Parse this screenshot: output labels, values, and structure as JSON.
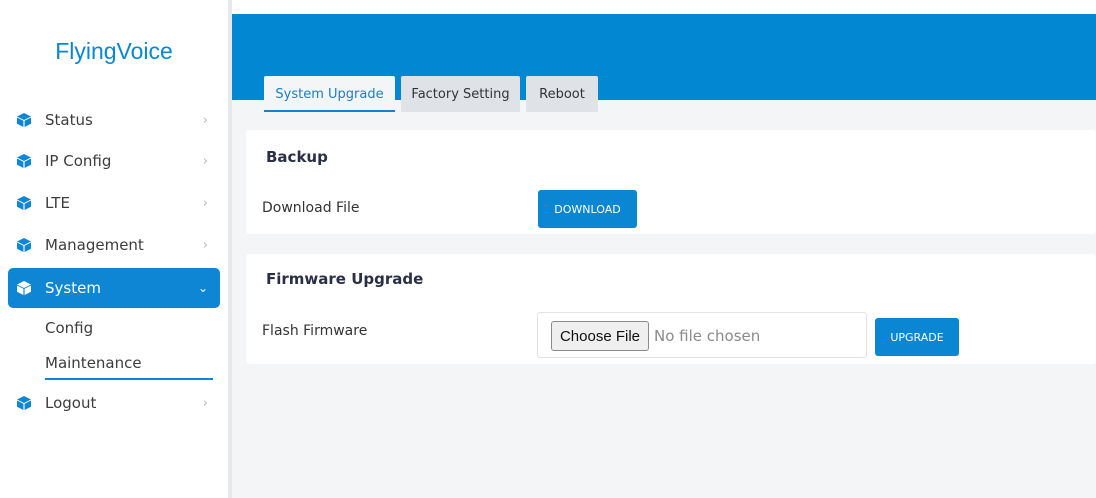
{
  "app": {
    "logo_text": "FlyingVoice"
  },
  "sidebar": {
    "items": [
      {
        "label": "Status",
        "icon": "cube-icon",
        "chevron": "›"
      },
      {
        "label": "IP Config",
        "icon": "cube-icon",
        "chevron": "›"
      },
      {
        "label": "LTE",
        "icon": "cube-icon",
        "chevron": "›"
      },
      {
        "label": "Management",
        "icon": "cube-icon",
        "chevron": "›"
      },
      {
        "label": "System",
        "icon": "cube-icon",
        "chevron": "⌄",
        "active": true
      },
      {
        "label": "Logout",
        "icon": "cube-icon",
        "chevron": "›"
      }
    ],
    "system_subitems": [
      {
        "label": "Config"
      },
      {
        "label": "Maintenance",
        "active": true
      }
    ]
  },
  "tabs": [
    {
      "label": "System Upgrade",
      "active": true
    },
    {
      "label": "Factory Setting"
    },
    {
      "label": "Reboot"
    }
  ],
  "backup": {
    "title": "Backup",
    "download_label": "Download File",
    "download_button": "DOWNLOAD"
  },
  "firmware": {
    "title": "Firmware Upgrade",
    "flash_label": "Flash Firmware",
    "choose_file_button": "Choose File",
    "no_file_text": "No file chosen",
    "upgrade_button": "UPGRADE"
  },
  "colors": {
    "accent": "#0287d3",
    "logo": "#0a86d4",
    "tab_inactive": "#dfe3e8",
    "content_bg": "#f3f5f7",
    "card_title": "#2a2f45"
  }
}
